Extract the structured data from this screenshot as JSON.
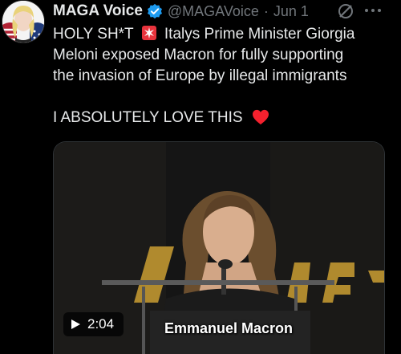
{
  "author": {
    "name": "MAGA Voice",
    "handle": "@MAGAVoice",
    "separator": "·",
    "date": "Jun 1"
  },
  "tweet": {
    "line1_prefix": "HOLY SH*T",
    "line1_suffix": "Italys Prime Minister Giorgia",
    "line2": "Meloni exposed Macron for fully supporting",
    "line3": "the invasion of Europe by illegal immigrants",
    "line4": "I ABSOLUTELY LOVE THIS"
  },
  "icons": {
    "verified": "verified-badge-icon",
    "grok": "grok-icon",
    "more": "more-options-icon",
    "siren": "police-siren-emoji",
    "heart": "red-heart-emoji",
    "play": "play-icon"
  },
  "video": {
    "duration": "2:04",
    "caption": "Emmanuel Macron"
  },
  "colors": {
    "background": "#000000",
    "text": "#e7e9ea",
    "secondary": "#71767b",
    "verified": "#1d9bf0",
    "heart": "#f4212e"
  }
}
